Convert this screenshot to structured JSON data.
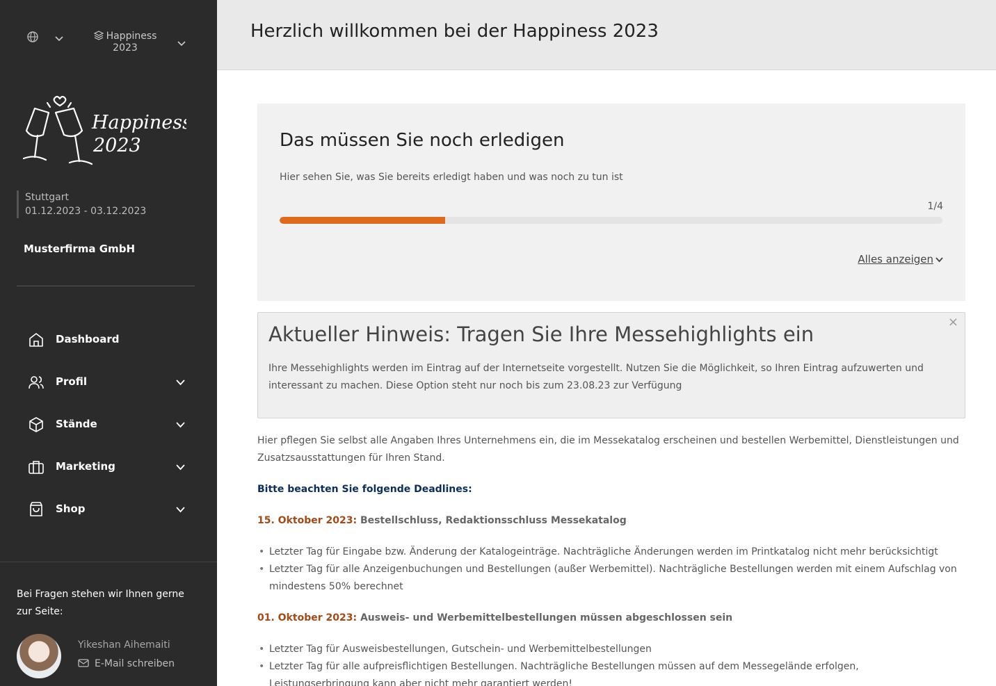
{
  "topbar": {
    "globe_icon": "globe-icon",
    "event_name_line1": "Happiness",
    "event_name_line2": "2023"
  },
  "logo": {
    "text_line1": "Happiness",
    "text_line2": "2023"
  },
  "event_info": {
    "city": "Stuttgart",
    "dates": "01.12.2023 - 03.12.2023"
  },
  "company": "Musterfirma GmbH",
  "nav": {
    "items": [
      {
        "label": "Dashboard",
        "icon": "home-icon"
      },
      {
        "label": "Profil",
        "icon": "users-icon"
      },
      {
        "label": "Stände",
        "icon": "box-icon"
      },
      {
        "label": "Marketing",
        "icon": "briefcase-icon"
      },
      {
        "label": "Shop",
        "icon": "shopping-bag-icon"
      }
    ]
  },
  "help": {
    "text": "Bei Fragen stehen wir Ihnen gerne zur Seite:",
    "contact_name": "Yikeshan Aihemaiti",
    "contact_mail_label": "E-Mail schreiben"
  },
  "header": {
    "title": "Herzlich willkommen bei der Happiness 2023"
  },
  "todo": {
    "title": "Das müssen Sie noch erledigen",
    "subtitle": "Hier sehen Sie, was Sie bereits erledigt haben und was noch zu tun ist",
    "count": "1/4",
    "progress_fraction": 0.25,
    "progress_color": "#e06a1b",
    "show_all_label": "Alles anzeigen"
  },
  "notice": {
    "title": "Aktueller Hinweis: Tragen Sie Ihre Messehighlights ein",
    "body": "Ihre Messehighlights werden im Eintrag auf der Internetseite vorgestellt. Nutzen Sie die Möglichkeit, so Ihren Eintrag aufzuwerten und interessant zu machen. Diese Option steht nur noch bis zum 23.08.23 zur Verfügung",
    "close_label": "×"
  },
  "content": {
    "intro": "Hier pflegen Sie selbst alle Angaben Ihres Unternehmens ein, die im Messekatalog erscheinen und bestellen Werbemittel, Dienstleistungen und Zusatzsausstattungen für Ihren Stand.",
    "deadlines_title": "Bitte beachten Sie folgende Deadlines:",
    "deadline1": {
      "date": "15. Oktober 2023:",
      "title": "Bestellschluss, Redaktionsschluss Messekatalog",
      "items": [
        "Letzter Tag für Eingabe bzw. Änderung der Katalogeinträge. Nachträgliche Änderungen werden im Printkatalog nicht mehr berücksichtigt",
        "Letzter Tag für alle Anzeigenbuchungen und Bestellungen (außer Werbemittel). Nachträgliche Bestellungen werden mit einem Aufschlag von mindestens 50% berechnet"
      ]
    },
    "deadline2": {
      "date": "01. Oktober 2023:",
      "title": "Ausweis- und Werbemittelbestellungen müssen abgeschlossen sein",
      "items": [
        "Letzter Tag für Ausweisbestellungen, Gutschein- und Werbemittelbestellungen",
        "Letzter Tag für alle aufpreisflichtigen Bestellungen. Nachträgliche Bestellungen müssen auf dem Messegelände erfolgen, Leistungserbringung kann aber nicht mehr garantiert werden!"
      ]
    }
  }
}
